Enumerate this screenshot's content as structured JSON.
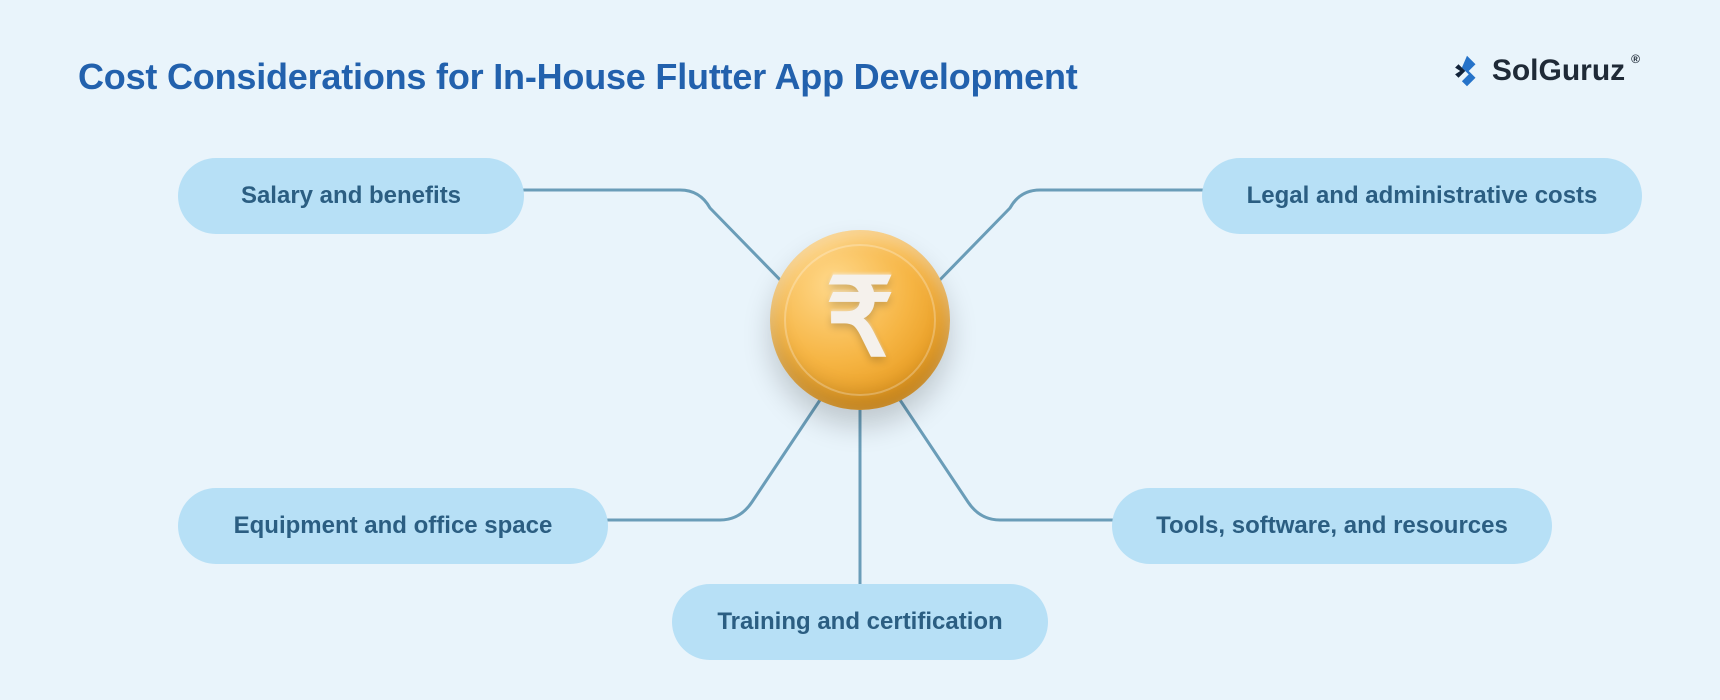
{
  "title": "Cost Considerations for In-House Flutter App Development",
  "brand": {
    "name": "SolGuruz",
    "registered": "®",
    "logo_name": "solguruz-logo-icon"
  },
  "center": {
    "icon_name": "rupee-coin-icon",
    "glyph": "₹"
  },
  "nodes": {
    "top_left": "Salary and benefits",
    "top_right": "Legal and administrative costs",
    "bottom_left": "Equipment and office space",
    "bottom_right": "Tools, software, and resources",
    "bottom_center": "Training and certification"
  },
  "colors": {
    "bg": "#e9f4fb",
    "title": "#2261ad",
    "pill_bg": "#b7e0f6",
    "pill_text": "#2b5e82",
    "connector": "#6a9db8",
    "coin_top": "#ffd88a",
    "coin_bottom": "#e79a1f"
  }
}
